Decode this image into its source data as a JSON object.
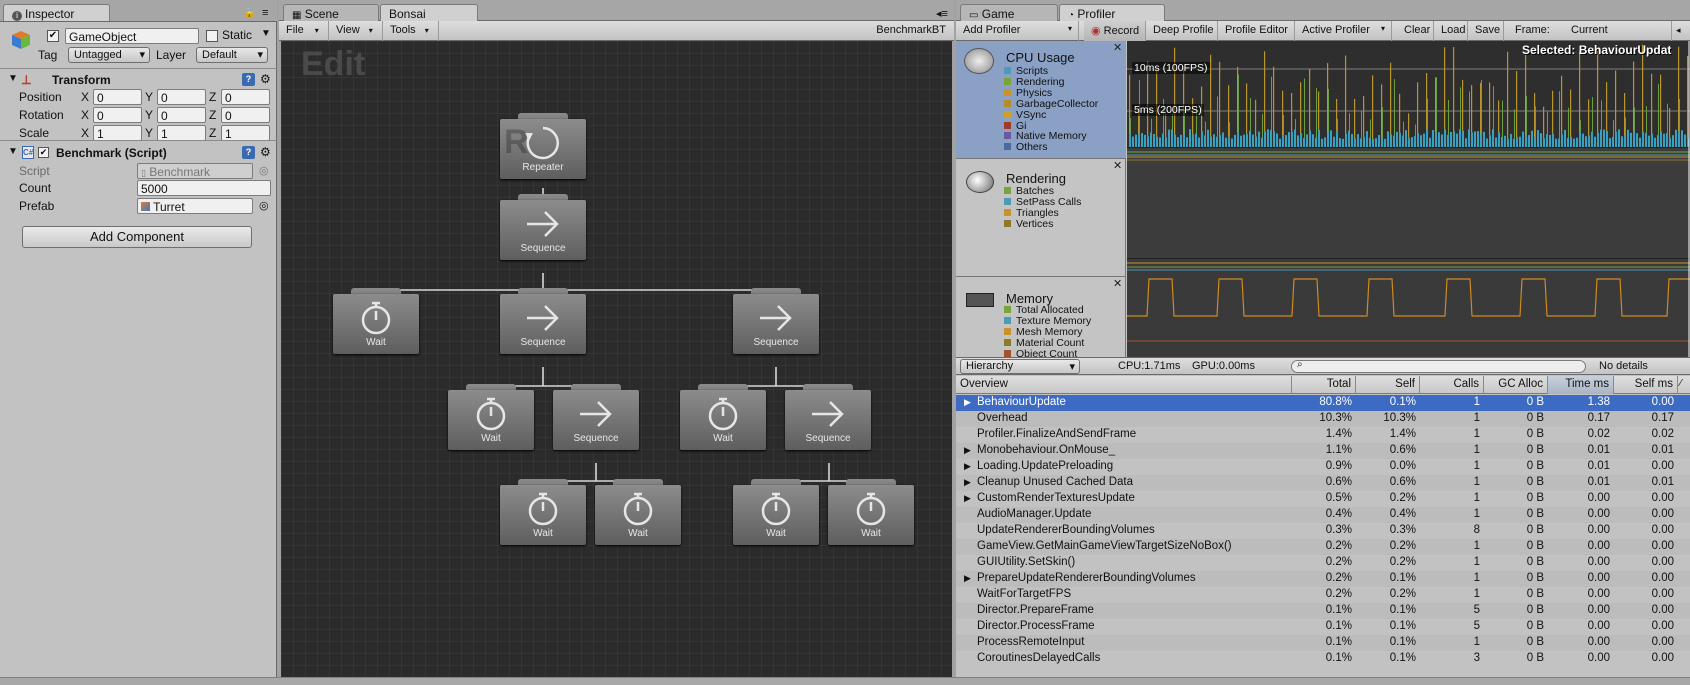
{
  "inspector": {
    "tab": "Inspector",
    "object_name": "GameObject",
    "static_label": "Static",
    "tag_label": "Tag",
    "tag_value": "Untagged",
    "layer_label": "Layer",
    "layer_value": "Default",
    "transform": {
      "title": "Transform",
      "rows": [
        {
          "label": "Position",
          "x": "0",
          "y": "0",
          "z": "0"
        },
        {
          "label": "Rotation",
          "x": "0",
          "y": "0",
          "z": "0"
        },
        {
          "label": "Scale",
          "x": "1",
          "y": "1",
          "z": "1"
        }
      ],
      "axis_x": "X",
      "axis_y": "Y",
      "axis_z": "Z"
    },
    "script_comp": {
      "title": "Benchmark (Script)",
      "script_label": "Script",
      "script_value": "Benchmark",
      "count_label": "Count",
      "count_value": "5000",
      "prefab_label": "Prefab",
      "prefab_value": "Turret"
    },
    "add_component": "Add Component"
  },
  "bonsai": {
    "tabs": [
      "Scene",
      "Bonsai"
    ],
    "menu": [
      "File",
      "View",
      "Tools"
    ],
    "title_right": "BenchmarkBT",
    "watermark": "Edit",
    "nodes": {
      "repeater": "Repeater",
      "sequence": "Sequence",
      "wait": "Wait"
    }
  },
  "profiler": {
    "tabs": [
      "Game",
      "Profiler"
    ],
    "toolbar": [
      "Add Profiler",
      "Record",
      "Deep Profile",
      "Profile Editor",
      "Active Profiler",
      "Clear",
      "Load",
      "Save",
      "Frame:",
      "Current"
    ],
    "selected": "Selected: BehaviourUpdat",
    "cpu": {
      "name": "CPU Usage",
      "legend": [
        {
          "name": "Scripts",
          "color": "#4a9ab8"
        },
        {
          "name": "Rendering",
          "color": "#7aa33a"
        },
        {
          "name": "Physics",
          "color": "#c8922c"
        },
        {
          "name": "GarbageCollector",
          "color": "#b58a2a"
        },
        {
          "name": "VSync",
          "color": "#c8a22c"
        },
        {
          "name": "Gi",
          "color": "#a23a2a"
        },
        {
          "name": "Native Memory",
          "color": "#6a5aa0"
        },
        {
          "name": "Others",
          "color": "#4a6aa0"
        }
      ],
      "marker_10": "10ms (100FPS)",
      "marker_5": "5ms (200FPS)"
    },
    "rendering": {
      "name": "Rendering",
      "legend": [
        {
          "name": "Batches",
          "color": "#7aa33a"
        },
        {
          "name": "SetPass Calls",
          "color": "#4a9ab8"
        },
        {
          "name": "Triangles",
          "color": "#c8922c"
        },
        {
          "name": "Vertices",
          "color": "#8a7a2a"
        }
      ]
    },
    "memory": {
      "name": "Memory",
      "legend": [
        {
          "name": "Total Allocated",
          "color": "#7aa33a"
        },
        {
          "name": "Texture Memory",
          "color": "#4a9ab8"
        },
        {
          "name": "Mesh Memory",
          "color": "#c8922c"
        },
        {
          "name": "Material Count",
          "color": "#8a7a2a"
        },
        {
          "name": "Object Count",
          "color": "#a2532a"
        }
      ]
    },
    "detail_bar": {
      "mode": "Hierarchy",
      "cpu": "CPU:1.71ms",
      "gpu": "GPU:0.00ms",
      "no_details": "No details"
    },
    "columns": [
      "Overview",
      "Total",
      "Self",
      "Calls",
      "GC Alloc",
      "Time ms",
      "Self ms"
    ],
    "rows": [
      {
        "name": "BehaviourUpdate",
        "total": "80.8%",
        "self": "0.1%",
        "calls": "1",
        "gc": "0 B",
        "time": "1.38",
        "selfms": "0.00",
        "expand": true,
        "selected": true
      },
      {
        "name": "Overhead",
        "total": "10.3%",
        "self": "10.3%",
        "calls": "1",
        "gc": "0 B",
        "time": "0.17",
        "selfms": "0.17",
        "expand": false
      },
      {
        "name": "Profiler.FinalizeAndSendFrame",
        "total": "1.4%",
        "self": "1.4%",
        "calls": "1",
        "gc": "0 B",
        "time": "0.02",
        "selfms": "0.02",
        "expand": false
      },
      {
        "name": "Monobehaviour.OnMouse_",
        "total": "1.1%",
        "self": "0.6%",
        "calls": "1",
        "gc": "0 B",
        "time": "0.01",
        "selfms": "0.01",
        "expand": true
      },
      {
        "name": "Loading.UpdatePreloading",
        "total": "0.9%",
        "self": "0.0%",
        "calls": "1",
        "gc": "0 B",
        "time": "0.01",
        "selfms": "0.00",
        "expand": true
      },
      {
        "name": "Cleanup Unused Cached Data",
        "total": "0.6%",
        "self": "0.6%",
        "calls": "1",
        "gc": "0 B",
        "time": "0.01",
        "selfms": "0.01",
        "expand": true
      },
      {
        "name": "CustomRenderTexturesUpdate",
        "total": "0.5%",
        "self": "0.2%",
        "calls": "1",
        "gc": "0 B",
        "time": "0.00",
        "selfms": "0.00",
        "expand": true
      },
      {
        "name": "AudioManager.Update",
        "total": "0.4%",
        "self": "0.4%",
        "calls": "1",
        "gc": "0 B",
        "time": "0.00",
        "selfms": "0.00",
        "expand": false
      },
      {
        "name": "UpdateRendererBoundingVolumes",
        "total": "0.3%",
        "self": "0.3%",
        "calls": "8",
        "gc": "0 B",
        "time": "0.00",
        "selfms": "0.00",
        "expand": false
      },
      {
        "name": "GameView.GetMainGameViewTargetSizeNoBox()",
        "total": "0.2%",
        "self": "0.2%",
        "calls": "1",
        "gc": "0 B",
        "time": "0.00",
        "selfms": "0.00",
        "expand": false
      },
      {
        "name": "GUIUtility.SetSkin()",
        "total": "0.2%",
        "self": "0.2%",
        "calls": "1",
        "gc": "0 B",
        "time": "0.00",
        "selfms": "0.00",
        "expand": false
      },
      {
        "name": "PrepareUpdateRendererBoundingVolumes",
        "total": "0.2%",
        "self": "0.1%",
        "calls": "1",
        "gc": "0 B",
        "time": "0.00",
        "selfms": "0.00",
        "expand": true
      },
      {
        "name": "WaitForTargetFPS",
        "total": "0.2%",
        "self": "0.2%",
        "calls": "1",
        "gc": "0 B",
        "time": "0.00",
        "selfms": "0.00",
        "expand": false
      },
      {
        "name": "Director.PrepareFrame",
        "total": "0.1%",
        "self": "0.1%",
        "calls": "5",
        "gc": "0 B",
        "time": "0.00",
        "selfms": "0.00",
        "expand": false
      },
      {
        "name": "Director.ProcessFrame",
        "total": "0.1%",
        "self": "0.1%",
        "calls": "5",
        "gc": "0 B",
        "time": "0.00",
        "selfms": "0.00",
        "expand": false
      },
      {
        "name": "ProcessRemoteInput",
        "total": "0.1%",
        "self": "0.1%",
        "calls": "1",
        "gc": "0 B",
        "time": "0.00",
        "selfms": "0.00",
        "expand": false
      },
      {
        "name": "CoroutinesDelayedCalls",
        "total": "0.1%",
        "self": "0.1%",
        "calls": "3",
        "gc": "0 B",
        "time": "0.00",
        "selfms": "0.00",
        "expand": false
      }
    ]
  }
}
